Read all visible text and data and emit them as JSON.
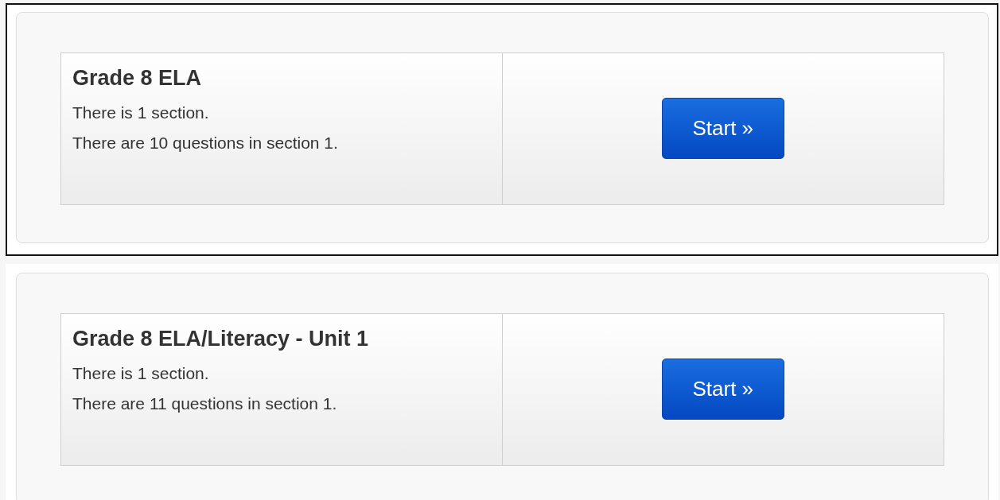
{
  "assessments": [
    {
      "title": "Grade 8 ELA",
      "lines": [
        "There is 1 section.",
        "There are 10 questions in section 1."
      ],
      "button": "Start »",
      "selected": true
    },
    {
      "title": "Grade 8 ELA/Literacy - Unit 1",
      "lines": [
        "There is 1 section.",
        "There are 11 questions in section 1."
      ],
      "button": "Start »",
      "selected": false
    }
  ]
}
